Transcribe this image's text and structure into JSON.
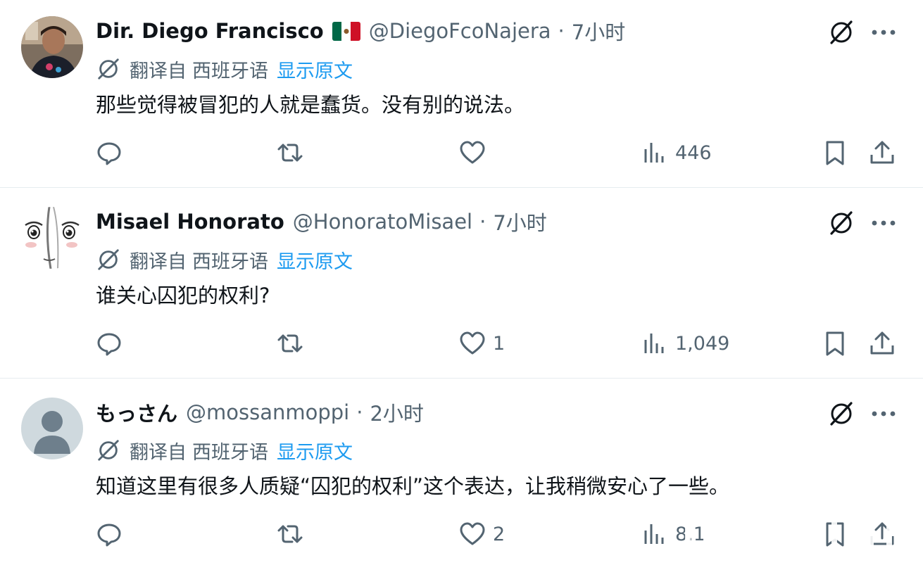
{
  "tweets": [
    {
      "name": "Dir. Diego Francisco",
      "handle": "@DiegoFcoNajera",
      "time": "7小时",
      "translate_label": "翻译自",
      "translate_lang": "西班牙语",
      "show_original": "显示原文",
      "text": "那些觉得被冒犯的人就是蠢货。没有别的说法。",
      "reply_count": "",
      "retweet_count": "",
      "like_count": "",
      "views": "446"
    },
    {
      "name": "Misael Honorato",
      "handle": "@HonoratoMisael",
      "time": "7小时",
      "translate_label": "翻译自",
      "translate_lang": "西班牙语",
      "show_original": "显示原文",
      "text": "谁关心囚犯的权利?",
      "reply_count": "",
      "retweet_count": "",
      "like_count": "1",
      "views": "1,049"
    },
    {
      "name": "もっさん",
      "handle": "@mossanmoppi",
      "time": "2小时",
      "translate_label": "翻译自",
      "translate_lang": "西班牙语",
      "show_original": "显示原文",
      "text": "知道这里有很多人质疑“囚犯的权利”这个表达，让我稍微安心了一些。",
      "reply_count": "",
      "retweet_count": "",
      "like_count": "2",
      "views": "",
      "views_obscured": "8.1"
    }
  ],
  "dot": "·",
  "colors": {
    "text_primary": "#0f1419",
    "text_secondary": "#536471",
    "link": "#1d9bf0",
    "divider": "#e6ecf0"
  },
  "icons": [
    "avatar",
    "mexico-flag-icon",
    "grok-icon",
    "more-icon",
    "translate-icon",
    "reply-icon",
    "retweet-icon",
    "like-icon",
    "views-icon",
    "bookmark-icon",
    "share-icon"
  ]
}
